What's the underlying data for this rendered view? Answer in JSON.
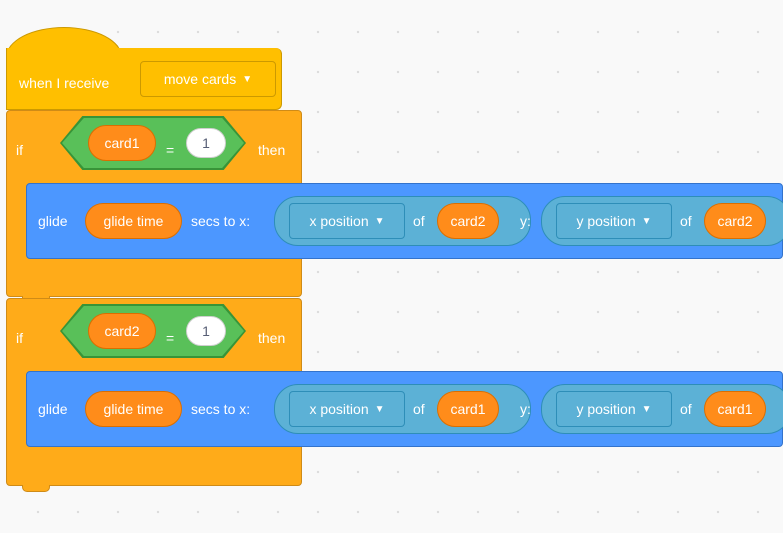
{
  "event": {
    "hat_label": "when I receive",
    "message": "move cards",
    "caret": "▼"
  },
  "if_blocks": [
    {
      "if_label": "if",
      "cond_var": "card1",
      "cond_op": "=",
      "cond_value": "1",
      "then_label": "then",
      "glide": {
        "glide_label": "glide",
        "duration_var": "glide time",
        "secs_label": "secs to x:",
        "x_attr": "x position",
        "x_of": "of",
        "x_target": "card2",
        "y_label": "y:",
        "y_attr": "y position",
        "y_of": "of",
        "y_target": "card2"
      }
    },
    {
      "if_label": "if",
      "cond_var": "card2",
      "cond_op": "=",
      "cond_value": "1",
      "then_label": "then",
      "glide": {
        "glide_label": "glide",
        "duration_var": "glide time",
        "secs_label": "secs to x:",
        "x_attr": "x position",
        "x_of": "of",
        "x_target": "card1",
        "y_label": "y:",
        "y_attr": "y position",
        "y_of": "of",
        "y_target": "card1"
      }
    }
  ],
  "colors": {
    "events": "#ffbf00",
    "control": "#ffab19",
    "motion": "#4c97ff",
    "operators": "#59c059",
    "variables": "#ff8c1a",
    "sensing": "#5cb1d6"
  }
}
